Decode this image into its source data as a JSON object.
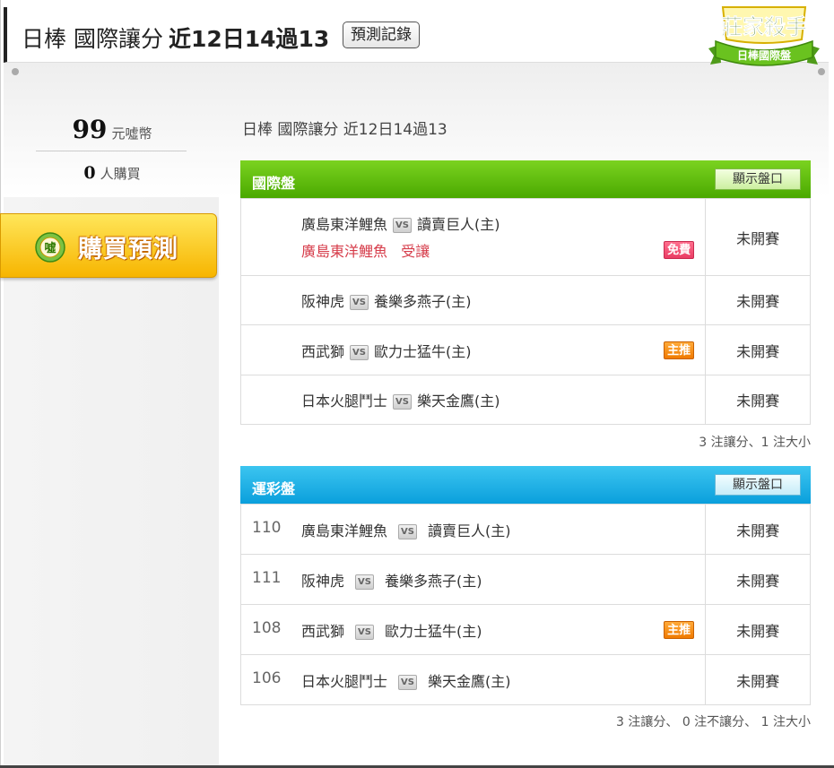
{
  "header": {
    "title_prefix": "日棒 國際讓分",
    "title_record": "近12日14過13",
    "record_button": "預測記錄",
    "logo_top": "莊家殺手",
    "logo_bottom": "日棒國際盤"
  },
  "sidebar": {
    "coins_value": "99",
    "coins_unit": "元噓幣",
    "buyers_value": "0",
    "buyers_unit": "人購買",
    "buy_button": "購買預測",
    "buy_icon_char": "噓"
  },
  "subtitle": "日棒 國際讓分 近12日14過13",
  "colors": {
    "green_header": "#4aa900",
    "blue_header": "#0a9fdc",
    "handicap_red": "#d63c4a",
    "free_tag": "#ea3d64",
    "top_tag": "#f07a00",
    "buy_button": "#f7b500"
  },
  "international": {
    "title": "國際盤",
    "show_button": "顯示盤口",
    "games": [
      {
        "away": "廣島東洋鯉魚",
        "vs": "VS",
        "home": "讀賣巨人(主)",
        "pick_team": "廣島東洋鯉魚",
        "pick": "受讓",
        "tag": "免費",
        "status": "未開賽"
      },
      {
        "away": "阪神虎",
        "vs": "VS",
        "home": "養樂多燕子(主)",
        "status": "未開賽"
      },
      {
        "away": "西武獅",
        "vs": "VS",
        "home": "歐力士猛牛(主)",
        "tag": "主推",
        "status": "未開賽"
      },
      {
        "away": "日本火腿鬥士",
        "vs": "VS",
        "home": "樂天金鷹(主)",
        "status": "未開賽"
      }
    ],
    "summary": "3 注讓分、1 注大小"
  },
  "sportslottery": {
    "title": "運彩盤",
    "show_button": "顯示盤口",
    "games": [
      {
        "code": "110",
        "away": "廣島東洋鯉魚",
        "vs": "VS",
        "home": "讀賣巨人(主)",
        "status": "未開賽"
      },
      {
        "code": "111",
        "away": "阪神虎",
        "vs": "VS",
        "home": "養樂多燕子(主)",
        "status": "未開賽"
      },
      {
        "code": "108",
        "away": "西武獅",
        "vs": "VS",
        "home": "歐力士猛牛(主)",
        "tag": "主推",
        "status": "未開賽"
      },
      {
        "code": "106",
        "away": "日本火腿鬥士",
        "vs": "VS",
        "home": "樂天金鷹(主)",
        "status": "未開賽"
      }
    ],
    "summary": "3 注讓分、 0 注不讓分、 1 注大小"
  }
}
